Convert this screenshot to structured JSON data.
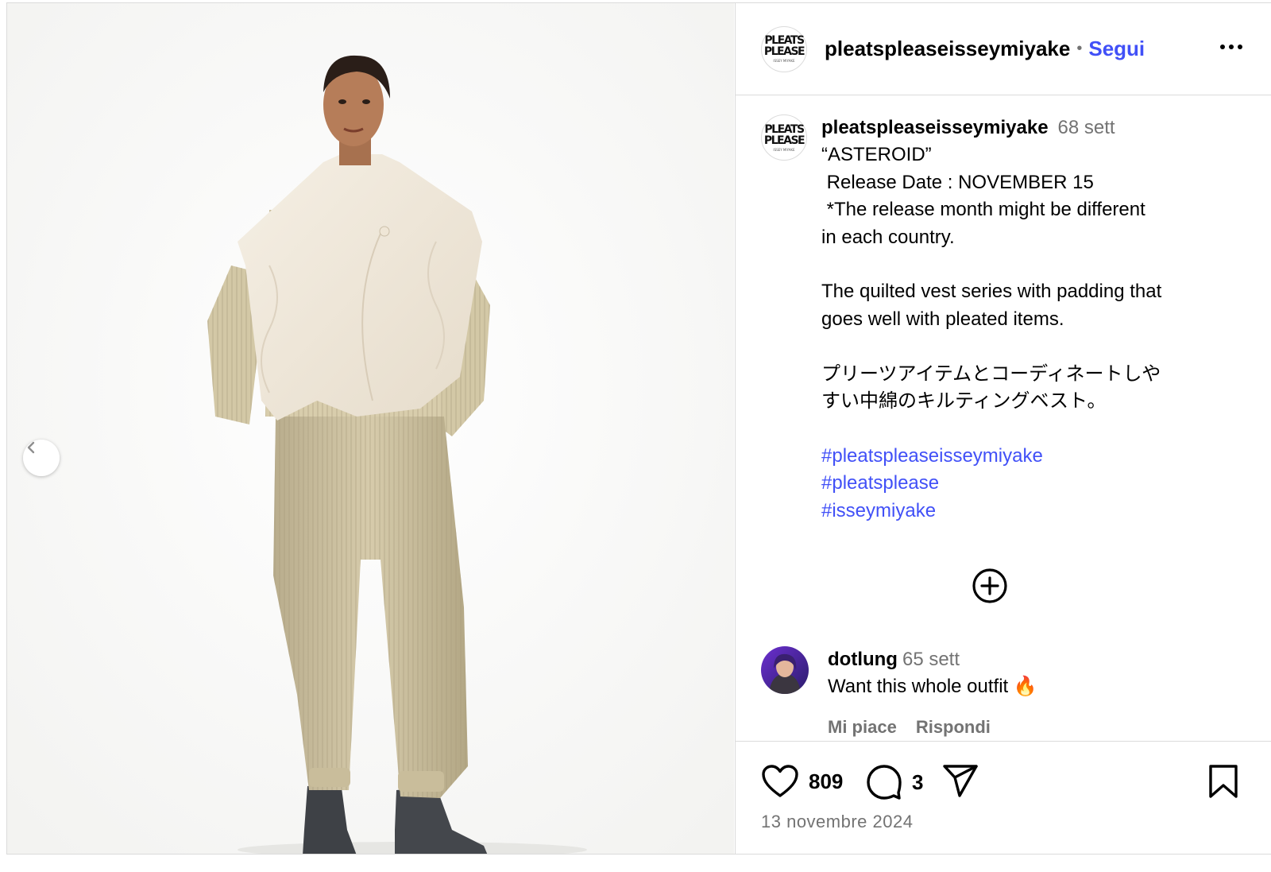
{
  "header": {
    "username": "pleatspleaseisseymiyake",
    "separator": "•",
    "follow_label": "Segui",
    "more_icon": "more-horizontal-icon"
  },
  "logo": {
    "line1": "PLEATS",
    "line2": "PLEASE",
    "line3": "ISSEY MIYAKE"
  },
  "media": {
    "prev_icon": "chevron-left-icon"
  },
  "caption": {
    "username": "pleatspleaseisseymiyake",
    "time": "68 sett",
    "lines": [
      "“ASTEROID”",
      " Release Date : NOVEMBER 15",
      " *The release month might be different",
      "in each country.",
      "",
      "The quilted vest series with padding that",
      "goes well with pleated items.",
      "",
      "プリーツアイテムとコーディネートしや",
      "すい中綿のキルティングベスト。",
      ""
    ],
    "hashtags": [
      "#pleatspleaseisseymiyake",
      "#pleatsplease",
      "#isseymiyake"
    ]
  },
  "load_more_icon": "plus-circle-icon",
  "comment": {
    "username": "dotlung",
    "time": "65 sett",
    "text": "Want this whole outfit 🔥",
    "like_label": "Mi piace",
    "reply_label": "Rispondi"
  },
  "footer": {
    "likes": "809",
    "comments": "3",
    "date": "13 novembre 2024",
    "icons": [
      "heart-icon",
      "comment-icon",
      "share-icon",
      "bookmark-icon"
    ]
  },
  "colors": {
    "link": "#4150f7",
    "muted": "#737373",
    "border": "#dbdbdb"
  }
}
